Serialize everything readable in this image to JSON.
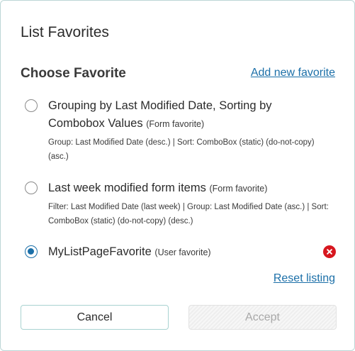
{
  "dialog": {
    "title": "List Favorites"
  },
  "choose": {
    "heading": "Choose Favorite",
    "add_link": "Add new favorite"
  },
  "favorites": [
    {
      "name": "Grouping by Last Modified Date, Sorting by Combobox Values",
      "kind": "(Form favorite)",
      "description": "Group: Last Modified Date (desc.) | Sort: ComboBox (static) (do-not-copy) (asc.)",
      "selected": false,
      "deletable": false
    },
    {
      "name": "Last week modified form items",
      "kind": "(Form favorite)",
      "description": "Filter: Last Modified Date (last week) | Group: Last Modified Date (asc.) | Sort: ComboBox (static) (do-not-copy) (desc.)",
      "selected": false,
      "deletable": false
    },
    {
      "name": "MyListPageFavorite",
      "kind": "(User favorite)",
      "description": "",
      "selected": true,
      "deletable": true
    }
  ],
  "reset_link": "Reset listing",
  "buttons": {
    "cancel": "Cancel",
    "accept": "Accept",
    "accept_disabled": true
  },
  "colors": {
    "accent": "#1b6fa8",
    "delete": "#d7171f",
    "cancel_border": "#a9d3d1"
  },
  "icons": {
    "delete": "close-circle-icon"
  }
}
